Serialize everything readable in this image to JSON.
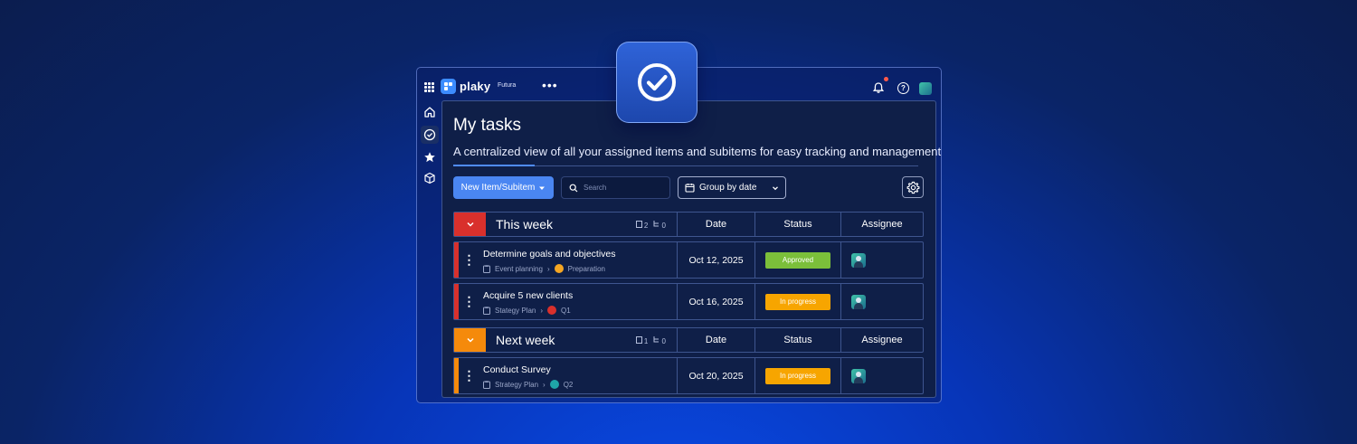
{
  "app": {
    "brand": "plaky",
    "workspace": "Futura"
  },
  "page": {
    "title": "My tasks",
    "subtitle": "A centralized view of all your assigned items and subitems for easy tracking and management"
  },
  "toolbar": {
    "new_button_label": "New Item/Subitem",
    "search_placeholder": "Search",
    "group_by_label": "Group by date"
  },
  "columns": {
    "date": "Date",
    "status": "Status",
    "assignee": "Assignee"
  },
  "groups": [
    {
      "title": "This week",
      "accent": "#d9302c",
      "item_count": "2",
      "subitem_count": "0",
      "rows": [
        {
          "name": "Determine goals and objectives",
          "board": "Event planning",
          "group": "Preparation",
          "group_color": "#f5a623",
          "date": "Oct 12, 2025",
          "status": "Approved",
          "status_color": "#7bbf3a"
        },
        {
          "name": "Acquire 5 new clients",
          "board": "Stategy Plan",
          "group": "Q1",
          "group_color": "#d9302c",
          "date": "Oct 16, 2025",
          "status": "In progress",
          "status_color": "#f7a500"
        }
      ]
    },
    {
      "title": "Next week",
      "accent": "#f58a0b",
      "item_count": "1",
      "subitem_count": "0",
      "rows": [
        {
          "name": "Conduct Survey",
          "board": "Strategy Plan",
          "group": "Q2",
          "group_color": "#1fa5a8",
          "date": "Oct 20, 2025",
          "status": "In progress",
          "status_color": "#f7a500"
        }
      ]
    }
  ]
}
